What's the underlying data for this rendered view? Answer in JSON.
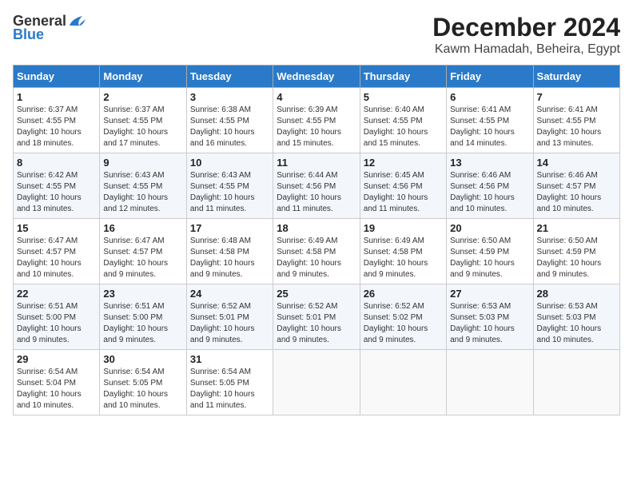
{
  "logo": {
    "general": "General",
    "blue": "Blue"
  },
  "title": "December 2024",
  "location": "Kawm Hamadah, Beheira, Egypt",
  "headers": [
    "Sunday",
    "Monday",
    "Tuesday",
    "Wednesday",
    "Thursday",
    "Friday",
    "Saturday"
  ],
  "weeks": [
    [
      {
        "day": "1",
        "sunrise": "6:37 AM",
        "sunset": "4:55 PM",
        "daylight": "10 hours and 18 minutes."
      },
      {
        "day": "2",
        "sunrise": "6:37 AM",
        "sunset": "4:55 PM",
        "daylight": "10 hours and 17 minutes."
      },
      {
        "day": "3",
        "sunrise": "6:38 AM",
        "sunset": "4:55 PM",
        "daylight": "10 hours and 16 minutes."
      },
      {
        "day": "4",
        "sunrise": "6:39 AM",
        "sunset": "4:55 PM",
        "daylight": "10 hours and 15 minutes."
      },
      {
        "day": "5",
        "sunrise": "6:40 AM",
        "sunset": "4:55 PM",
        "daylight": "10 hours and 15 minutes."
      },
      {
        "day": "6",
        "sunrise": "6:41 AM",
        "sunset": "4:55 PM",
        "daylight": "10 hours and 14 minutes."
      },
      {
        "day": "7",
        "sunrise": "6:41 AM",
        "sunset": "4:55 PM",
        "daylight": "10 hours and 13 minutes."
      }
    ],
    [
      {
        "day": "8",
        "sunrise": "6:42 AM",
        "sunset": "4:55 PM",
        "daylight": "10 hours and 13 minutes."
      },
      {
        "day": "9",
        "sunrise": "6:43 AM",
        "sunset": "4:55 PM",
        "daylight": "10 hours and 12 minutes."
      },
      {
        "day": "10",
        "sunrise": "6:43 AM",
        "sunset": "4:55 PM",
        "daylight": "10 hours and 11 minutes."
      },
      {
        "day": "11",
        "sunrise": "6:44 AM",
        "sunset": "4:56 PM",
        "daylight": "10 hours and 11 minutes."
      },
      {
        "day": "12",
        "sunrise": "6:45 AM",
        "sunset": "4:56 PM",
        "daylight": "10 hours and 11 minutes."
      },
      {
        "day": "13",
        "sunrise": "6:46 AM",
        "sunset": "4:56 PM",
        "daylight": "10 hours and 10 minutes."
      },
      {
        "day": "14",
        "sunrise": "6:46 AM",
        "sunset": "4:57 PM",
        "daylight": "10 hours and 10 minutes."
      }
    ],
    [
      {
        "day": "15",
        "sunrise": "6:47 AM",
        "sunset": "4:57 PM",
        "daylight": "10 hours and 10 minutes."
      },
      {
        "day": "16",
        "sunrise": "6:47 AM",
        "sunset": "4:57 PM",
        "daylight": "10 hours and 9 minutes."
      },
      {
        "day": "17",
        "sunrise": "6:48 AM",
        "sunset": "4:58 PM",
        "daylight": "10 hours and 9 minutes."
      },
      {
        "day": "18",
        "sunrise": "6:49 AM",
        "sunset": "4:58 PM",
        "daylight": "10 hours and 9 minutes."
      },
      {
        "day": "19",
        "sunrise": "6:49 AM",
        "sunset": "4:58 PM",
        "daylight": "10 hours and 9 minutes."
      },
      {
        "day": "20",
        "sunrise": "6:50 AM",
        "sunset": "4:59 PM",
        "daylight": "10 hours and 9 minutes."
      },
      {
        "day": "21",
        "sunrise": "6:50 AM",
        "sunset": "4:59 PM",
        "daylight": "10 hours and 9 minutes."
      }
    ],
    [
      {
        "day": "22",
        "sunrise": "6:51 AM",
        "sunset": "5:00 PM",
        "daylight": "10 hours and 9 minutes."
      },
      {
        "day": "23",
        "sunrise": "6:51 AM",
        "sunset": "5:00 PM",
        "daylight": "10 hours and 9 minutes."
      },
      {
        "day": "24",
        "sunrise": "6:52 AM",
        "sunset": "5:01 PM",
        "daylight": "10 hours and 9 minutes."
      },
      {
        "day": "25",
        "sunrise": "6:52 AM",
        "sunset": "5:01 PM",
        "daylight": "10 hours and 9 minutes."
      },
      {
        "day": "26",
        "sunrise": "6:52 AM",
        "sunset": "5:02 PM",
        "daylight": "10 hours and 9 minutes."
      },
      {
        "day": "27",
        "sunrise": "6:53 AM",
        "sunset": "5:03 PM",
        "daylight": "10 hours and 9 minutes."
      },
      {
        "day": "28",
        "sunrise": "6:53 AM",
        "sunset": "5:03 PM",
        "daylight": "10 hours and 10 minutes."
      }
    ],
    [
      {
        "day": "29",
        "sunrise": "6:54 AM",
        "sunset": "5:04 PM",
        "daylight": "10 hours and 10 minutes."
      },
      {
        "day": "30",
        "sunrise": "6:54 AM",
        "sunset": "5:05 PM",
        "daylight": "10 hours and 10 minutes."
      },
      {
        "day": "31",
        "sunrise": "6:54 AM",
        "sunset": "5:05 PM",
        "daylight": "10 hours and 11 minutes."
      },
      null,
      null,
      null,
      null
    ]
  ],
  "labels": {
    "sunrise": "Sunrise:",
    "sunset": "Sunset:",
    "daylight": "Daylight:"
  }
}
